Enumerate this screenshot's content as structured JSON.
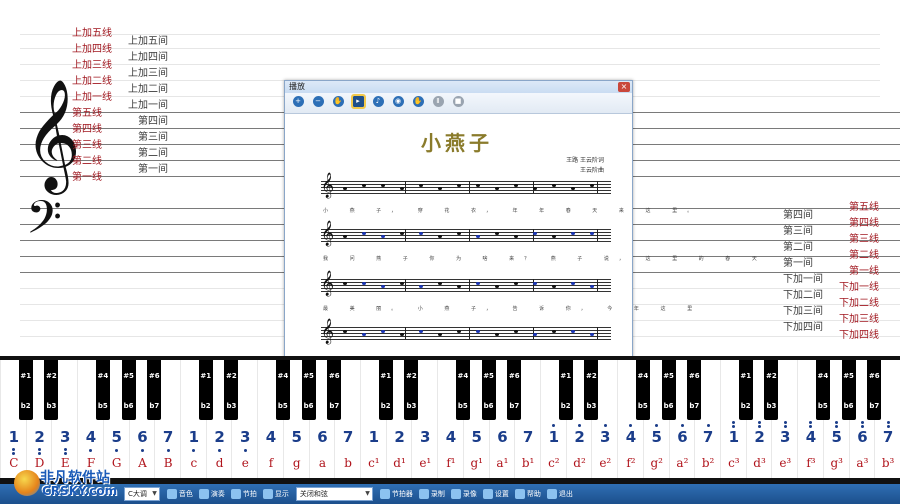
{
  "staff": {
    "left_line_labels": [
      "上加五线",
      "上加四线",
      "上加三线",
      "上加二线",
      "上加一线",
      "第五线",
      "第四线",
      "第三线",
      "第二线",
      "第一线"
    ],
    "left_space_labels": [
      "上加五间",
      "上加四间",
      "上加三间",
      "上加二间",
      "上加一间",
      "第四间",
      "第三间",
      "第二间",
      "第一间"
    ],
    "right_space_labels": [
      "第四间",
      "第三间",
      "第二间",
      "第一间",
      "下加一间",
      "下加二间",
      "下加三间",
      "下加四间"
    ],
    "right_line_labels": [
      "第五线",
      "第四线",
      "第三线",
      "第二线",
      "第一线",
      "下加一线",
      "下加二线",
      "下加三线",
      "下加四线"
    ],
    "treble_clef": "𝄞",
    "bass_clef": "𝄢"
  },
  "window": {
    "title": "播放",
    "close": "×",
    "toolbar": [
      {
        "icon": "zoom-in-icon",
        "glyph": "+"
      },
      {
        "icon": "zoom-out-icon",
        "glyph": "−"
      },
      {
        "icon": "hand-icon",
        "glyph": "✋"
      },
      {
        "icon": "select-icon",
        "glyph": "▸"
      },
      {
        "icon": "play-icon",
        "glyph": "♪"
      },
      {
        "icon": "record-icon",
        "glyph": "◉"
      },
      {
        "icon": "hand-tool-icon",
        "glyph": "✋"
      },
      {
        "icon": "pause-icon",
        "glyph": "Ⅱ"
      },
      {
        "icon": "stop-icon",
        "glyph": "■"
      }
    ],
    "song_title": "小燕子",
    "credit_lyrics": "王路 王云阶词",
    "credit_music": "王云阶曲",
    "lyrics": [
      "小 燕 子， 穿 花 衣， 年 年 春 天 来 这 里。",
      "我 问 燕 子 你 为 啥 来？ 燕 子 说， 这 里 的 春 天",
      "最 美 丽。 小 燕 子， 告 诉 你， 今 年 这 里",
      ""
    ]
  },
  "piano": {
    "white_keys": [
      {
        "num": "1",
        "dots": "below2",
        "name": "C"
      },
      {
        "num": "2",
        "dots": "below2",
        "name": "D"
      },
      {
        "num": "3",
        "dots": "below2",
        "name": "E"
      },
      {
        "num": "4",
        "dots": "below1",
        "name": "F"
      },
      {
        "num": "5",
        "dots": "below1",
        "name": "G"
      },
      {
        "num": "6",
        "dots": "below1",
        "name": "A"
      },
      {
        "num": "7",
        "dots": "below1",
        "name": "B"
      },
      {
        "num": "1",
        "dots": "below1",
        "name": "c"
      },
      {
        "num": "2",
        "dots": "below1",
        "name": "d"
      },
      {
        "num": "3",
        "dots": "below1",
        "name": "e"
      },
      {
        "num": "4",
        "dots": "",
        "name": "f"
      },
      {
        "num": "5",
        "dots": "",
        "name": "g"
      },
      {
        "num": "6",
        "dots": "",
        "name": "a"
      },
      {
        "num": "7",
        "dots": "",
        "name": "b"
      },
      {
        "num": "1",
        "dots": "",
        "name": "c¹"
      },
      {
        "num": "2",
        "dots": "",
        "name": "d¹"
      },
      {
        "num": "3",
        "dots": "",
        "name": "e¹"
      },
      {
        "num": "4",
        "dots": "",
        "name": "f¹"
      },
      {
        "num": "5",
        "dots": "",
        "name": "g¹"
      },
      {
        "num": "6",
        "dots": "",
        "name": "a¹"
      },
      {
        "num": "7",
        "dots": "",
        "name": "b¹"
      },
      {
        "num": "1",
        "dots": "above1",
        "name": "c²"
      },
      {
        "num": "2",
        "dots": "above1",
        "name": "d²"
      },
      {
        "num": "3",
        "dots": "above1",
        "name": "e²"
      },
      {
        "num": "4",
        "dots": "above1",
        "name": "f²"
      },
      {
        "num": "5",
        "dots": "above1",
        "name": "g²"
      },
      {
        "num": "6",
        "dots": "above1",
        "name": "a²"
      },
      {
        "num": "7",
        "dots": "above1",
        "name": "b²"
      },
      {
        "num": "1",
        "dots": "above2",
        "name": "c³"
      },
      {
        "num": "2",
        "dots": "above2",
        "name": "d³"
      },
      {
        "num": "3",
        "dots": "above2",
        "name": "e³"
      },
      {
        "num": "4",
        "dots": "above2",
        "name": "f³"
      },
      {
        "num": "5",
        "dots": "above2",
        "name": "g³"
      },
      {
        "num": "6",
        "dots": "above2",
        "name": "a³"
      },
      {
        "num": "7",
        "dots": "above2",
        "name": "b³"
      }
    ],
    "black_top_labels": [
      "#1",
      "#2",
      "#4",
      "#5",
      "#6"
    ],
    "black_bottom_labels": [
      "b2",
      "b3",
      "b5",
      "b6",
      "b7"
    ]
  },
  "bottombar": {
    "key_select": "C大调",
    "buttons": [
      "音色",
      "演奏",
      "节拍",
      "显示",
      "关闭和弦",
      "节拍器",
      "录制",
      "录像",
      "设置",
      "帮助",
      "退出"
    ],
    "scale_select": "关闭和弦"
  },
  "logo": {
    "name": "非凡软件站",
    "sub": "CRSKY.com"
  }
}
